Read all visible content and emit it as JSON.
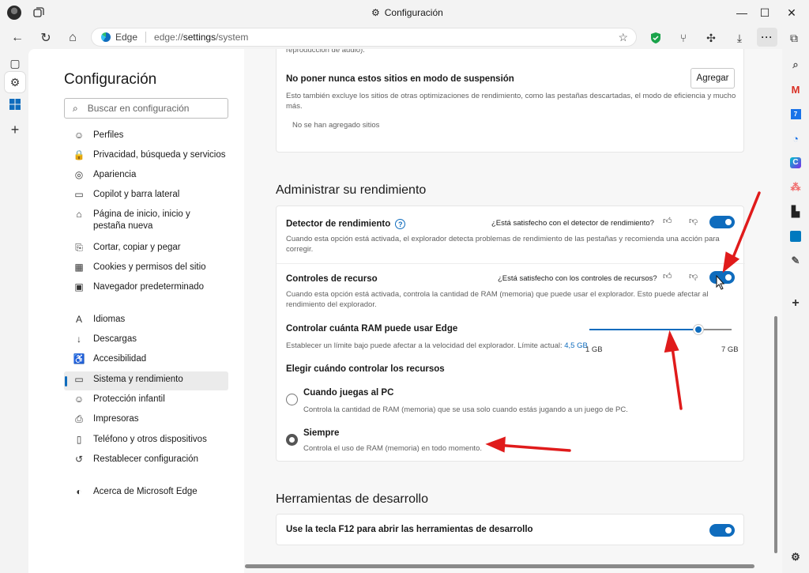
{
  "window": {
    "title": "Configuración",
    "minimize_glyph": "—",
    "maximize_glyph": "☐",
    "close_glyph": "✕"
  },
  "address_bar": {
    "browser_label": "Edge",
    "url_dim": "edge://",
    "url_bold": "settings",
    "url_rest": "/system"
  },
  "settings_nav": {
    "title": "Configuración",
    "search_placeholder": "Buscar en configuración",
    "items": [
      {
        "label": "Perfiles",
        "icon": "☺"
      },
      {
        "label": "Privacidad, búsqueda y servicios",
        "icon": "🔒"
      },
      {
        "label": "Apariencia",
        "icon": "◎"
      },
      {
        "label": "Copilot y barra lateral",
        "icon": "▭"
      },
      {
        "label": "Página de inicio, inicio y pestaña nueva",
        "icon": "⌂"
      },
      {
        "label": "Cortar, copiar y pegar",
        "icon": "⎘"
      },
      {
        "label": "Cookies y permisos del sitio",
        "icon": "▦"
      },
      {
        "label": "Navegador predeterminado",
        "icon": "▣"
      },
      {
        "label": "Idiomas",
        "icon": "A"
      },
      {
        "label": "Descargas",
        "icon": "↓"
      },
      {
        "label": "Accesibilidad",
        "icon": "♿"
      },
      {
        "label": "Sistema y rendimiento",
        "icon": "▭"
      },
      {
        "label": "Protección infantil",
        "icon": "☺"
      },
      {
        "label": "Impresoras",
        "icon": "⎙"
      },
      {
        "label": "Teléfono y otros dispositivos",
        "icon": "▯"
      },
      {
        "label": "Restablecer configuración",
        "icon": "↺"
      },
      {
        "label": "Acerca de Microsoft Edge",
        "icon": "◐"
      }
    ]
  },
  "sleeping_card": {
    "cut_text": "reproducción de audio).",
    "title": "No poner nunca estos sitios en modo de suspensión",
    "add_button": "Agregar",
    "description": "Esto también excluye los sitios de otras optimizaciones de rendimiento, como las pestañas descartadas, el modo de eficiencia y mucho más.",
    "empty_text": "No se han agregado sitios"
  },
  "performance": {
    "heading": "Administrar su rendimiento",
    "detector": {
      "title": "Detector de rendimiento",
      "help": "?",
      "feedback": "¿Está satisfecho con el detector de rendimiento?",
      "description": "Cuando esta opción está activada, el explorador detecta problemas de rendimiento de las pestañas y recomienda una acción para corregir.",
      "enabled": true
    },
    "resource_controls": {
      "title": "Controles de recurso",
      "feedback": "¿Está satisfecho con los controles de recursos?",
      "description": "Cuando esta opción está activada, controla la cantidad de RAM (memoria) que puede usar el explorador. Esto puede afectar al rendimiento del explorador.",
      "enabled": true
    },
    "ram": {
      "title": "Controlar cuánta RAM puede usar Edge",
      "description_prefix": "Establecer un límite bajo puede afectar a la velocidad del explorador. Límite actual:",
      "current_limit": "4,5 GB",
      "min_label": "1 GB",
      "max_label": "7 GB",
      "min_value": 1,
      "max_value": 7,
      "value": 5.6
    },
    "when": {
      "title": "Elegir cuándo controlar los recursos",
      "options": [
        {
          "label": "Cuando juegas al PC",
          "description": "Controla la cantidad de RAM (memoria) que se usa solo cuando estás jugando a un juego de PC.",
          "selected": false
        },
        {
          "label": "Siempre",
          "description": "Controla el uso de RAM (memoria) en todo momento.",
          "selected": true
        }
      ]
    }
  },
  "devtools": {
    "heading": "Herramientas de desarrollo",
    "f12_label": "Use la tecla F12 para abrir las herramientas de desarrollo",
    "enabled": true
  },
  "colors": {
    "accent": "#0f6cbd",
    "annotation_arrow": "#e01b1b"
  }
}
